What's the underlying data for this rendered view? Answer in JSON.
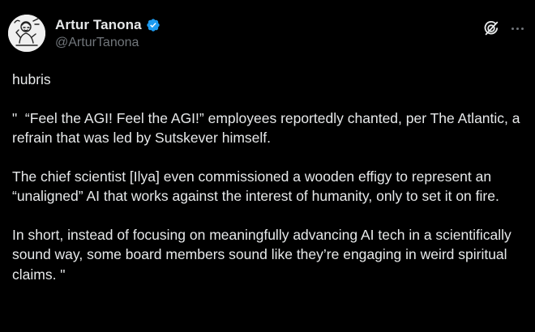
{
  "author": {
    "display_name": "Artur Tanona",
    "handle": "@ArturTanona",
    "verified": true,
    "verified_color": "#1d9bf0"
  },
  "icons": {
    "grok": "grok-icon",
    "more": "more-icon",
    "verified": "verified-badge-icon"
  },
  "tweet": {
    "paragraphs": [
      "hubris",
      "\"  “Feel the AGI! Feel the AGI!” employees reportedly chanted, per The Atlantic, a refrain that was led by Sutskever himself.",
      "The chief scientist [Ilya] even commissioned a wooden effigy to represent an “unaligned” AI that works against the interest of humanity, only to set it on fire.",
      "In short, instead of focusing on meaningfully advancing AI tech in a scientifically sound way, some board members sound like they’re engaging in weird spiritual claims. \""
    ]
  },
  "colors": {
    "background": "#000000",
    "text_primary": "#e7e9ea",
    "text_secondary": "#71767b"
  }
}
